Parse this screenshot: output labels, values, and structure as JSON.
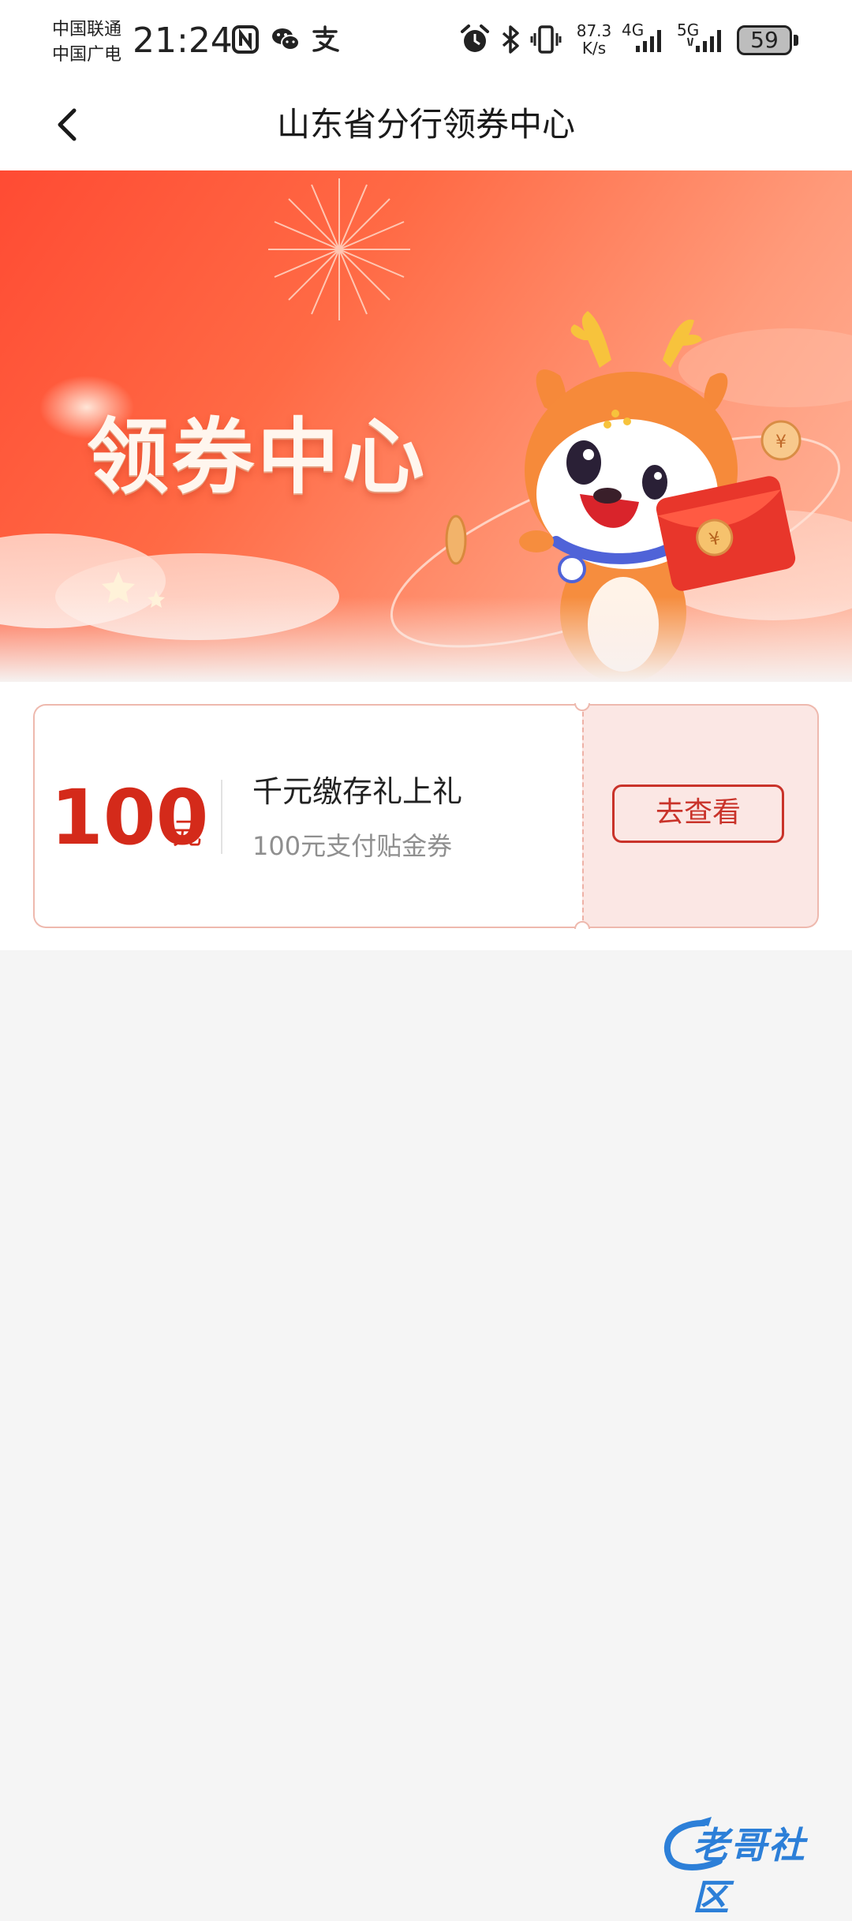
{
  "status_bar": {
    "carrier_1": "中国联通",
    "carrier_2": "中国广电",
    "time": "21:24",
    "net_speed_value": "87.3",
    "net_speed_unit": "K/s",
    "net_type_1": "4G",
    "net_type_2": "5G",
    "battery_level": "59",
    "icons": [
      "nfc-icon",
      "wechat-icon",
      "alipay-icon",
      "alarm-icon",
      "bluetooth-icon",
      "vibrate-icon",
      "signal-4g-icon",
      "signal-5g-icon",
      "battery-icon"
    ]
  },
  "nav": {
    "title": "山东省分行领券中心",
    "back_icon": "chevron-left-icon"
  },
  "banner": {
    "heading": "领券中心"
  },
  "coupons": [
    {
      "amount": "100",
      "unit": "元",
      "title": "千元缴存礼上礼",
      "subtitle": "100元支付贴金券",
      "action_label": "去查看"
    }
  ],
  "watermark": {
    "brand": "老哥社区"
  },
  "colors": {
    "accent_red": "#d42a1a",
    "button_red": "#c9332a",
    "coupon_border": "#eeb9ae",
    "coupon_stub_bg": "#fbe7e4",
    "page_bg": "#f5f5f5"
  }
}
